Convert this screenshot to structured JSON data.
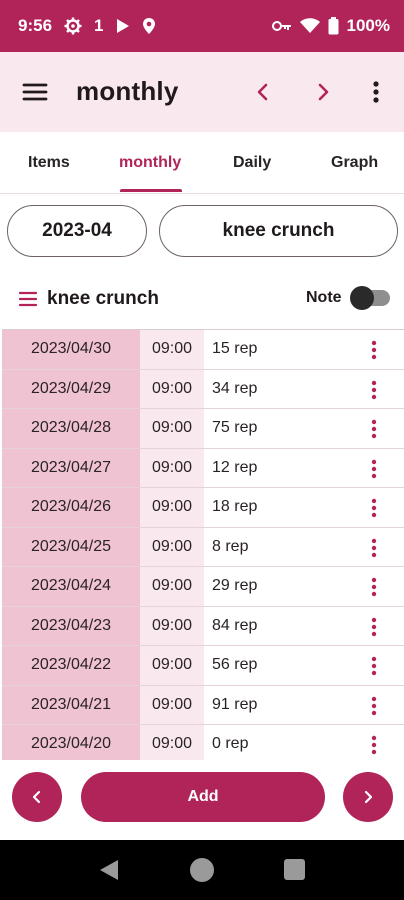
{
  "status_bar": {
    "time": "9:56",
    "notification_count": "1",
    "battery": "100%"
  },
  "app_bar": {
    "title": "monthly",
    "icons": [
      "menu-icon",
      "chevron-left-icon",
      "chevron-right-icon",
      "more-vert-icon"
    ]
  },
  "tabs": [
    {
      "label": "Items",
      "active": false
    },
    {
      "label": "monthly",
      "active": true
    },
    {
      "label": "Daily",
      "active": false
    },
    {
      "label": "Graph",
      "active": false
    }
  ],
  "filters": {
    "month": "2023-04",
    "item": "knee crunch"
  },
  "item_header": {
    "name": "knee crunch",
    "note_label": "Note",
    "note_enabled": false
  },
  "records": [
    {
      "date": "2023/04/30",
      "time": "09:00",
      "value": "15 rep"
    },
    {
      "date": "2023/04/29",
      "time": "09:00",
      "value": "34 rep"
    },
    {
      "date": "2023/04/28",
      "time": "09:00",
      "value": "75 rep"
    },
    {
      "date": "2023/04/27",
      "time": "09:00",
      "value": "12 rep"
    },
    {
      "date": "2023/04/26",
      "time": "09:00",
      "value": "18 rep"
    },
    {
      "date": "2023/04/25",
      "time": "09:00",
      "value": "8 rep"
    },
    {
      "date": "2023/04/24",
      "time": "09:00",
      "value": "29 rep"
    },
    {
      "date": "2023/04/23",
      "time": "09:00",
      "value": "84 rep"
    },
    {
      "date": "2023/04/22",
      "time": "09:00",
      "value": "56 rep"
    },
    {
      "date": "2023/04/21",
      "time": "09:00",
      "value": "91 rep"
    },
    {
      "date": "2023/04/20",
      "time": "09:00",
      "value": "0 rep"
    }
  ],
  "bottom_bar": {
    "add_label": "Add"
  },
  "colors": {
    "accent": "#b0245a",
    "app_bar_bg": "#f9e8ee",
    "date_cell_bg": "#f0c3d2",
    "time_cell_bg": "#f9e9ee"
  }
}
